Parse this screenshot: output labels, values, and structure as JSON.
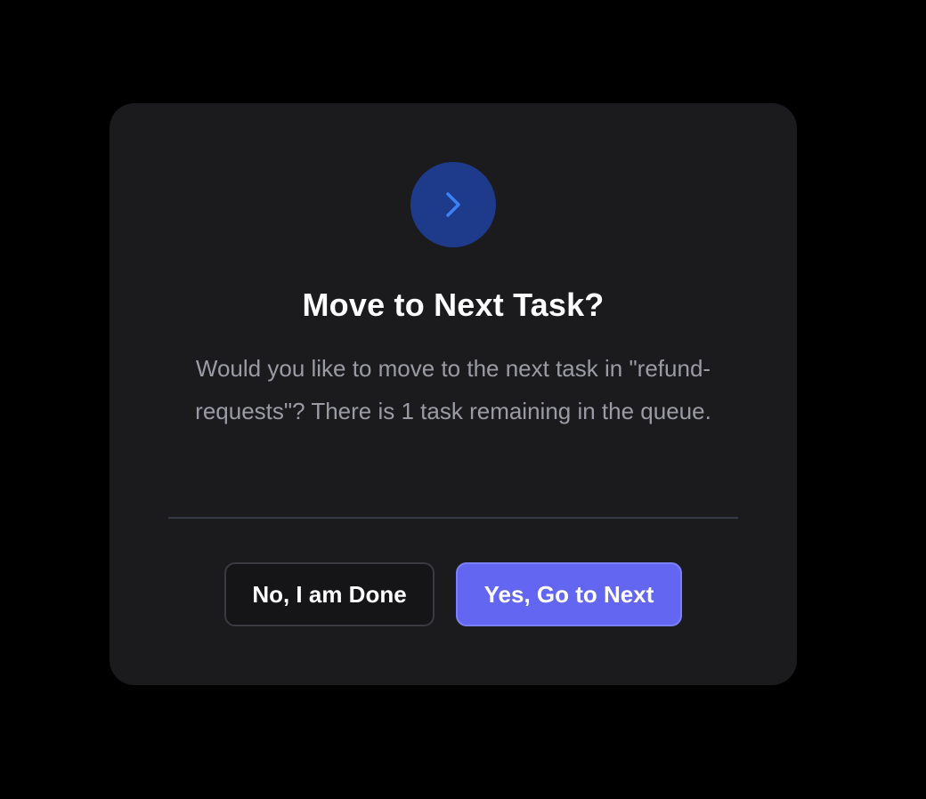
{
  "dialog": {
    "icon": "chevron-right-icon",
    "title": "Move to Next Task?",
    "message": "Would you like to move to the next task in \"refund-requests\"? There is 1 task remaining in the queue.",
    "buttons": {
      "secondary_label": "No, I am Done",
      "primary_label": "Yes, Go to Next"
    }
  },
  "colors": {
    "backdrop": "#000000",
    "dialog_bg": "#1b1b1e",
    "icon_circle": "#1e3a8a",
    "icon_stroke": "#3b82f6",
    "title_text": "#ffffff",
    "message_text": "#9b9ba6",
    "primary_button": "#6366f1"
  }
}
